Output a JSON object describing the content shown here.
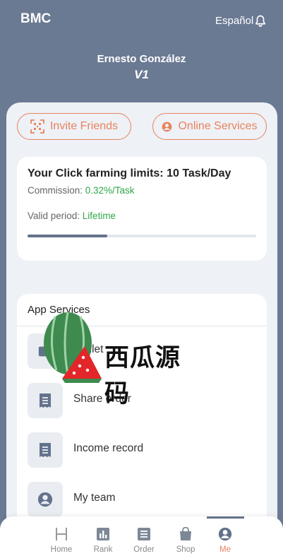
{
  "header": {
    "brand": "BMC",
    "language": "Español",
    "user_name": "Ernesto González",
    "vip_badge": "V1"
  },
  "actions": {
    "invite": "Invite Friends",
    "online_services": "Online Services"
  },
  "limits": {
    "title": "Your Click farming limits: 10 Task/Day",
    "commission_label": "Commission: ",
    "commission_value": "0.32%/Task",
    "valid_label": "Valid period: ",
    "valid_value": "Lifetime",
    "progress_fraction": 0.35
  },
  "services": {
    "title": "App Services",
    "items": [
      {
        "label": "Wallet",
        "icon": "wallet-icon"
      },
      {
        "label": "Share order",
        "icon": "receipt-icon"
      },
      {
        "label": "Income record",
        "icon": "receipt-icon"
      },
      {
        "label": "My team",
        "icon": "person-circle-icon"
      }
    ]
  },
  "watermark": {
    "text": "西瓜源码"
  },
  "nav": {
    "items": [
      {
        "label": "Home",
        "icon": "home-icon"
      },
      {
        "label": "Rank",
        "icon": "rank-icon"
      },
      {
        "label": "Order",
        "icon": "order-icon"
      },
      {
        "label": "Shop",
        "icon": "shop-icon"
      },
      {
        "label": "Me",
        "icon": "me-icon"
      }
    ],
    "active": "Me"
  },
  "colors": {
    "header_bg": "#6b7a93",
    "accent": "#e8835e",
    "positive": "#2fa64a",
    "progress": "#63728c"
  }
}
